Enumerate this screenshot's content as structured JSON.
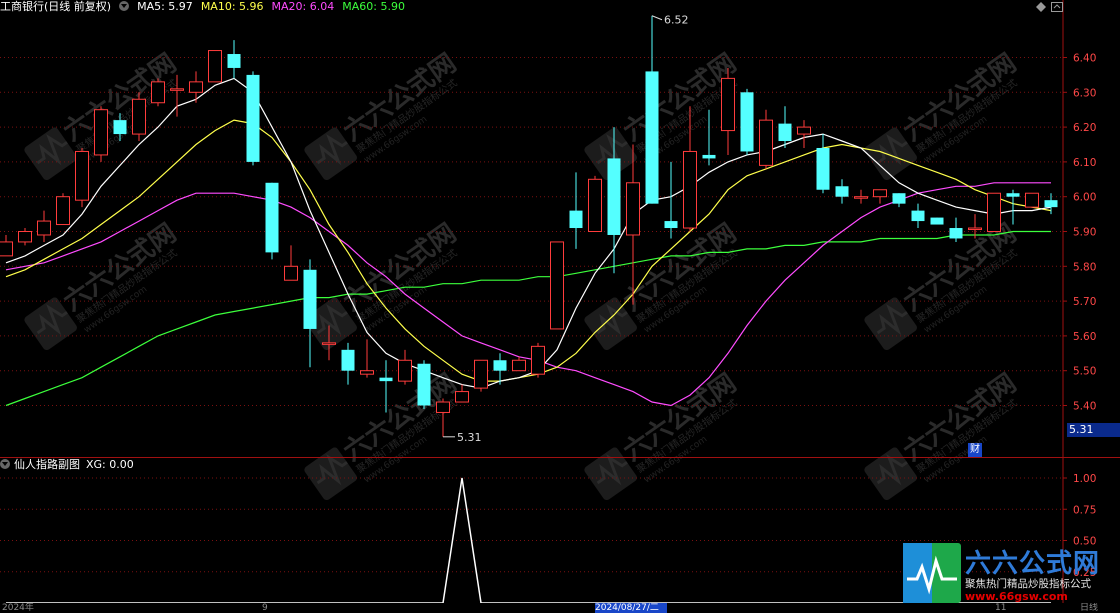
{
  "header": {
    "stock_title": "工商银行(日线 前复权)",
    "ma5": "MA5: 5.97",
    "ma10": "MA10: 5.96",
    "ma20": "MA20: 6.04",
    "ma60": "MA60: 5.90"
  },
  "colors": {
    "up_candle": "#ff3c3c",
    "down_candle": "#54ffff",
    "ma5": "#ffffff",
    "ma10": "#ffff4c",
    "ma20": "#ff4cff",
    "ma60": "#3cff3c",
    "grid": "#7a1010",
    "axis_text": "#ff4848",
    "watermark_text": "#2a2a2a"
  },
  "price_axis_ticks": [
    "6.40",
    "6.30",
    "6.20",
    "6.10",
    "6.00",
    "5.90",
    "5.80",
    "5.70",
    "5.60",
    "5.50",
    "5.40"
  ],
  "current_price_tag": "5.31",
  "annotations": {
    "high": "6.52",
    "low": "5.31"
  },
  "event_badge": "财",
  "sub_chart": {
    "title": "仙人指路副图",
    "xg": "XG: 0.00",
    "ticks": [
      "1.00",
      "0.75",
      "0.50",
      "0.25"
    ]
  },
  "bottom_axis": {
    "left_label": "2024年",
    "mid_label": "9",
    "date_box": "2024/08/27/二",
    "right_label": "11",
    "period_label": "日线"
  },
  "watermark": {
    "brand": "六六公式网",
    "slogan": "聚焦热门精品炒股指标公式",
    "url": "www.66gsw.com"
  },
  "chart_data": {
    "type": "candlestick",
    "ylim": [
      5.31,
      6.52
    ],
    "candles": [
      {
        "o": 5.83,
        "h": 5.89,
        "l": 5.83,
        "c": 5.87
      },
      {
        "o": 5.87,
        "h": 5.91,
        "l": 5.86,
        "c": 5.9
      },
      {
        "o": 5.89,
        "h": 5.96,
        "l": 5.87,
        "c": 5.93
      },
      {
        "o": 5.92,
        "h": 6.01,
        "l": 5.92,
        "c": 6.0
      },
      {
        "o": 5.99,
        "h": 6.14,
        "l": 5.97,
        "c": 6.13
      },
      {
        "o": 6.12,
        "h": 6.26,
        "l": 6.1,
        "c": 6.25
      },
      {
        "o": 6.22,
        "h": 6.24,
        "l": 6.16,
        "c": 6.18
      },
      {
        "o": 6.18,
        "h": 6.3,
        "l": 6.16,
        "c": 6.28
      },
      {
        "o": 6.27,
        "h": 6.34,
        "l": 6.26,
        "c": 6.33
      },
      {
        "o": 6.31,
        "h": 6.35,
        "l": 6.23,
        "c": 6.31
      },
      {
        "o": 6.3,
        "h": 6.36,
        "l": 6.27,
        "c": 6.33
      },
      {
        "o": 6.33,
        "h": 6.42,
        "l": 6.33,
        "c": 6.42
      },
      {
        "o": 6.41,
        "h": 6.45,
        "l": 6.34,
        "c": 6.37
      },
      {
        "o": 6.35,
        "h": 6.36,
        "l": 6.09,
        "c": 6.1
      },
      {
        "o": 6.04,
        "h": 6.04,
        "l": 5.82,
        "c": 5.84
      },
      {
        "o": 5.76,
        "h": 5.86,
        "l": 5.76,
        "c": 5.8
      },
      {
        "o": 5.79,
        "h": 5.82,
        "l": 5.51,
        "c": 5.62
      },
      {
        "o": 5.58,
        "h": 5.63,
        "l": 5.53,
        "c": 5.58
      },
      {
        "o": 5.56,
        "h": 5.58,
        "l": 5.46,
        "c": 5.5
      },
      {
        "o": 5.49,
        "h": 5.59,
        "l": 5.48,
        "c": 5.5
      },
      {
        "o": 5.48,
        "h": 5.53,
        "l": 5.38,
        "c": 5.47
      },
      {
        "o": 5.47,
        "h": 5.56,
        "l": 5.46,
        "c": 5.53
      },
      {
        "o": 5.52,
        "h": 5.53,
        "l": 5.39,
        "c": 5.4
      },
      {
        "o": 5.38,
        "h": 5.42,
        "l": 5.31,
        "c": 5.41
      },
      {
        "o": 5.41,
        "h": 5.46,
        "l": 5.41,
        "c": 5.44
      },
      {
        "o": 5.45,
        "h": 5.53,
        "l": 5.44,
        "c": 5.53
      },
      {
        "o": 5.53,
        "h": 5.55,
        "l": 5.46,
        "c": 5.5
      },
      {
        "o": 5.5,
        "h": 5.54,
        "l": 5.5,
        "c": 5.53
      },
      {
        "o": 5.49,
        "h": 5.58,
        "l": 5.48,
        "c": 5.57
      },
      {
        "o": 5.62,
        "h": 5.87,
        "l": 5.62,
        "c": 5.87
      },
      {
        "o": 5.96,
        "h": 6.07,
        "l": 5.85,
        "c": 5.91
      },
      {
        "o": 5.9,
        "h": 6.06,
        "l": 5.9,
        "c": 6.05
      },
      {
        "o": 6.11,
        "h": 6.2,
        "l": 5.78,
        "c": 5.89
      },
      {
        "o": 5.89,
        "h": 6.15,
        "l": 5.69,
        "c": 6.04
      },
      {
        "o": 6.36,
        "h": 6.52,
        "l": 5.98,
        "c": 5.98
      },
      {
        "o": 5.93,
        "h": 6.1,
        "l": 5.88,
        "c": 5.91
      },
      {
        "o": 5.91,
        "h": 6.26,
        "l": 5.9,
        "c": 6.13
      },
      {
        "o": 6.12,
        "h": 6.25,
        "l": 6.09,
        "c": 6.11
      },
      {
        "o": 6.19,
        "h": 6.37,
        "l": 6.12,
        "c": 6.34
      },
      {
        "o": 6.3,
        "h": 6.31,
        "l": 6.12,
        "c": 6.13
      },
      {
        "o": 6.09,
        "h": 6.25,
        "l": 6.08,
        "c": 6.22
      },
      {
        "o": 6.21,
        "h": 6.26,
        "l": 6.14,
        "c": 6.16
      },
      {
        "o": 6.18,
        "h": 6.22,
        "l": 6.14,
        "c": 6.2
      },
      {
        "o": 6.14,
        "h": 6.18,
        "l": 6.01,
        "c": 6.02
      },
      {
        "o": 6.03,
        "h": 6.05,
        "l": 5.98,
        "c": 6.0
      },
      {
        "o": 6.0,
        "h": 6.02,
        "l": 5.98,
        "c": 6.0
      },
      {
        "o": 6.0,
        "h": 6.02,
        "l": 5.98,
        "c": 6.02
      },
      {
        "o": 6.01,
        "h": 6.01,
        "l": 5.97,
        "c": 5.98
      },
      {
        "o": 5.96,
        "h": 5.98,
        "l": 5.91,
        "c": 5.93
      },
      {
        "o": 5.94,
        "h": 5.94,
        "l": 5.92,
        "c": 5.92
      },
      {
        "o": 5.91,
        "h": 5.94,
        "l": 5.87,
        "c": 5.88
      },
      {
        "o": 5.91,
        "h": 5.95,
        "l": 5.88,
        "c": 5.91
      },
      {
        "o": 5.9,
        "h": 6.01,
        "l": 5.9,
        "c": 6.01
      },
      {
        "o": 6.01,
        "h": 6.02,
        "l": 5.92,
        "c": 6.0
      },
      {
        "o": 5.97,
        "h": 6.01,
        "l": 5.97,
        "c": 6.01
      },
      {
        "o": 5.99,
        "h": 6.01,
        "l": 5.95,
        "c": 5.97
      }
    ],
    "ma5": [
      5.81,
      5.83,
      5.86,
      5.89,
      5.95,
      6.03,
      6.09,
      6.15,
      6.2,
      6.26,
      6.28,
      6.32,
      6.34,
      6.3,
      6.2,
      6.1,
      5.96,
      5.84,
      5.72,
      5.61,
      5.55,
      5.52,
      5.5,
      5.48,
      5.46,
      5.45,
      5.47,
      5.48,
      5.5,
      5.56,
      5.68,
      5.78,
      5.85,
      5.95,
      5.99,
      6.0,
      6.03,
      6.07,
      6.1,
      6.12,
      6.13,
      6.15,
      6.17,
      6.18,
      6.16,
      6.14,
      6.09,
      6.04,
      6.01,
      5.99,
      5.97,
      5.96,
      5.95,
      5.96,
      5.96,
      5.97
    ],
    "ma10": [
      5.77,
      5.79,
      5.82,
      5.85,
      5.88,
      5.92,
      5.96,
      6.0,
      6.05,
      6.1,
      6.15,
      6.19,
      6.22,
      6.21,
      6.17,
      6.1,
      6.02,
      5.92,
      5.84,
      5.75,
      5.68,
      5.62,
      5.57,
      5.53,
      5.49,
      5.47,
      5.47,
      5.48,
      5.49,
      5.51,
      5.55,
      5.61,
      5.66,
      5.72,
      5.8,
      5.85,
      5.9,
      5.95,
      6.02,
      6.06,
      6.08,
      6.1,
      6.12,
      6.14,
      6.15,
      6.14,
      6.13,
      6.11,
      6.09,
      6.07,
      6.05,
      6.02,
      6.0,
      5.98,
      5.97,
      5.96
    ],
    "ma20": [
      5.79,
      5.8,
      5.81,
      5.83,
      5.85,
      5.87,
      5.9,
      5.93,
      5.96,
      5.99,
      6.01,
      6.01,
      6.01,
      6.0,
      5.99,
      5.97,
      5.94,
      5.9,
      5.86,
      5.81,
      5.77,
      5.72,
      5.68,
      5.64,
      5.6,
      5.58,
      5.56,
      5.54,
      5.53,
      5.51,
      5.5,
      5.48,
      5.46,
      5.44,
      5.41,
      5.4,
      5.43,
      5.48,
      5.55,
      5.63,
      5.7,
      5.76,
      5.81,
      5.86,
      5.9,
      5.94,
      5.97,
      5.99,
      6.01,
      6.02,
      6.03,
      6.03,
      6.04,
      6.04,
      6.04,
      6.04
    ],
    "ma60": [
      5.4,
      5.42,
      5.44,
      5.46,
      5.48,
      5.51,
      5.54,
      5.57,
      5.6,
      5.62,
      5.64,
      5.66,
      5.67,
      5.68,
      5.69,
      5.7,
      5.71,
      5.71,
      5.72,
      5.72,
      5.73,
      5.74,
      5.74,
      5.75,
      5.75,
      5.76,
      5.76,
      5.76,
      5.77,
      5.77,
      5.78,
      5.79,
      5.8,
      5.81,
      5.82,
      5.83,
      5.83,
      5.84,
      5.84,
      5.85,
      5.85,
      5.86,
      5.86,
      5.87,
      5.87,
      5.87,
      5.88,
      5.88,
      5.88,
      5.88,
      5.89,
      5.89,
      5.89,
      5.9,
      5.9,
      5.9
    ],
    "sub_values": [
      0,
      0,
      0,
      0,
      0,
      0,
      0,
      0,
      0,
      0,
      0,
      0,
      0,
      0,
      0,
      0,
      0,
      0,
      0,
      0,
      0,
      0,
      0,
      0,
      1,
      0,
      0,
      0,
      0,
      0,
      0,
      0,
      0,
      0,
      0,
      0,
      0,
      0,
      0,
      0,
      0,
      0,
      0,
      0,
      0,
      0,
      0,
      0,
      0,
      0,
      0,
      0,
      0,
      0,
      0,
      0
    ],
    "sub_ylim": [
      0,
      1
    ]
  }
}
